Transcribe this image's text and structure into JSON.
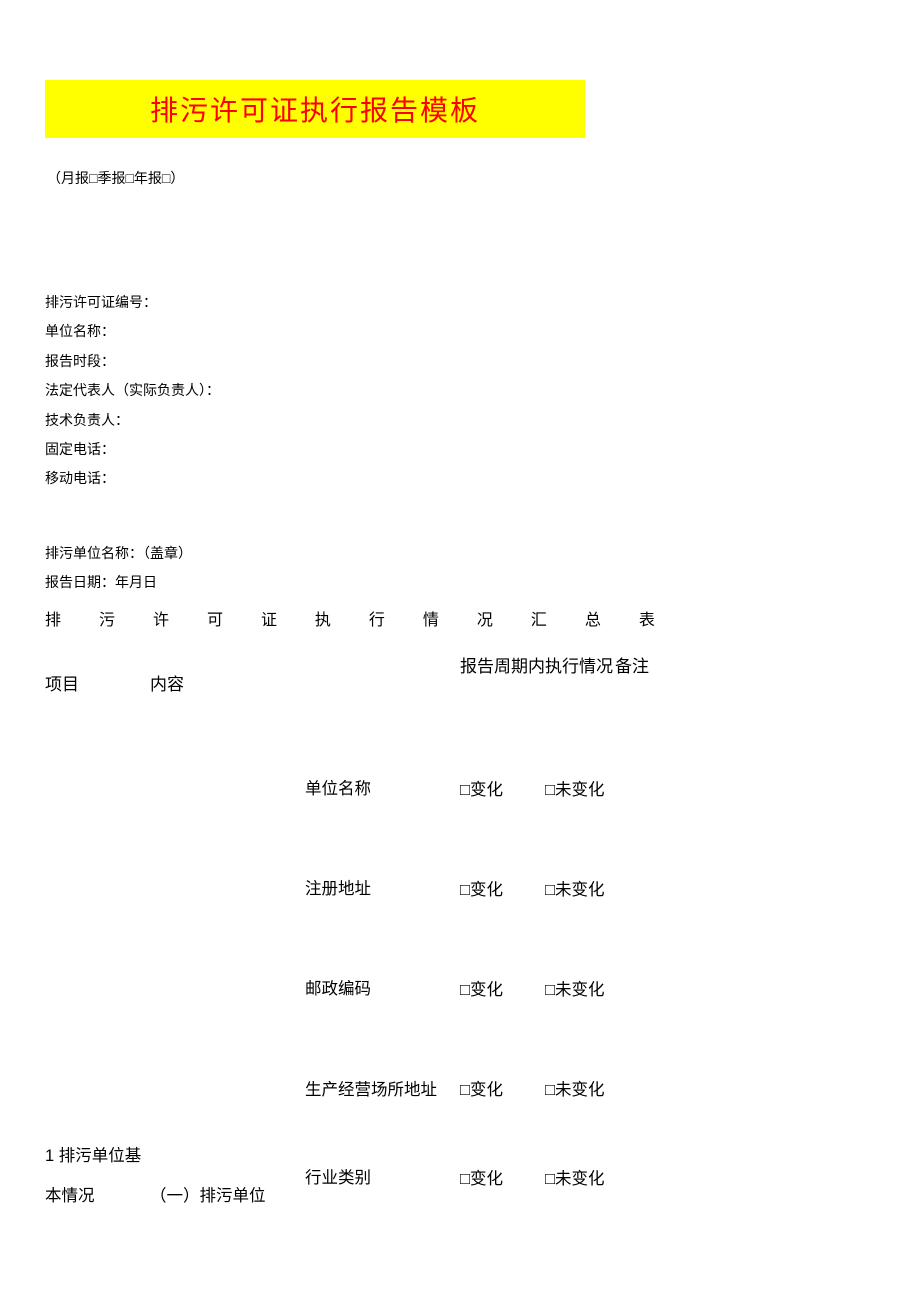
{
  "title": "排污许可证执行报告模板",
  "subtitle": "（月报□季报□年报□）",
  "info": {
    "permit_no": "排污许可证编号：",
    "unit_name": "单位名称：",
    "report_period": "报告时段：",
    "legal_rep": "法定代表人（实际负责人）：",
    "tech_lead": "技术负责人：",
    "fixed_phone": "固定电话：",
    "mobile_phone": "移动电话："
  },
  "stamp": {
    "unit_stamp": "排污单位名称：（盖章）",
    "report_date": "报告日期：年月日"
  },
  "summary_title_chars": [
    "排",
    "污",
    "许",
    "可",
    "证",
    "执",
    "行",
    "情",
    "况",
    "汇",
    "总",
    "表"
  ],
  "table": {
    "headers": {
      "project": "项目",
      "content": "内容",
      "period": "报告周期内执行情况",
      "remark": "备注"
    },
    "project_cell": "1 排污单位基本情况",
    "section_cell": "（一）排污单位",
    "rows": [
      {
        "item": "单位名称",
        "opt1": "□变化",
        "opt2": "□未变化"
      },
      {
        "item": "注册地址",
        "opt1": "□变化",
        "opt2": "□未变化"
      },
      {
        "item": "邮政编码",
        "opt1": "□变化",
        "opt2": "□未变化"
      },
      {
        "item": "生产经营场所地址",
        "opt1": "□变化",
        "opt2": "□未变化"
      },
      {
        "item": "行业类别",
        "opt1": "□变化",
        "opt2": "□未变化"
      }
    ]
  }
}
